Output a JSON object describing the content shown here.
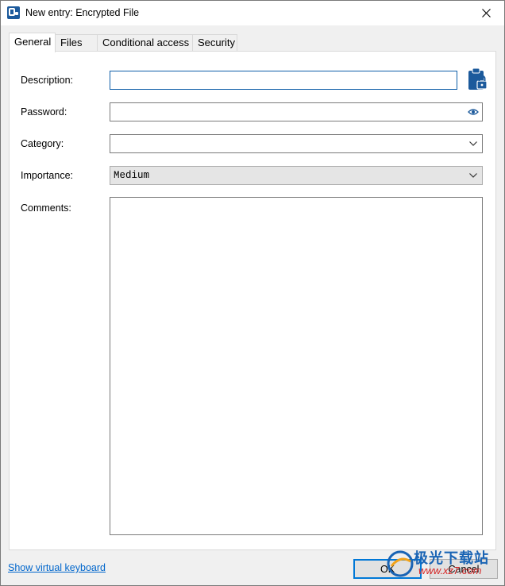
{
  "window": {
    "title": "New entry: Encrypted File"
  },
  "tabs": [
    {
      "label": "General",
      "active": true
    },
    {
      "label": "Files",
      "active": false
    },
    {
      "label": "Conditional access",
      "active": false
    },
    {
      "label": "Security",
      "active": false
    }
  ],
  "form": {
    "description": {
      "label": "Description:",
      "value": ""
    },
    "password": {
      "label": "Password:",
      "value": ""
    },
    "category": {
      "label": "Category:",
      "value": ""
    },
    "importance": {
      "label": "Importance:",
      "value": "Medium"
    },
    "comments": {
      "label": "Comments:",
      "value": ""
    }
  },
  "footer": {
    "virtual_keyboard_link": "Show virtual keyboard",
    "ok_label": "OK",
    "cancel_label": "Cancel"
  },
  "watermark": {
    "line1": "极光下载站",
    "line2": "www.xz7.com"
  },
  "icons": {
    "app": "app-logo-icon",
    "close": "close-icon",
    "clipboard_lock": "clipboard-lock-icon",
    "eye": "eye-icon",
    "chevron": "chevron-down-icon"
  },
  "colors": {
    "accent": "#0078d7",
    "link": "#0066cc",
    "icon_blue": "#1c5a9c"
  }
}
